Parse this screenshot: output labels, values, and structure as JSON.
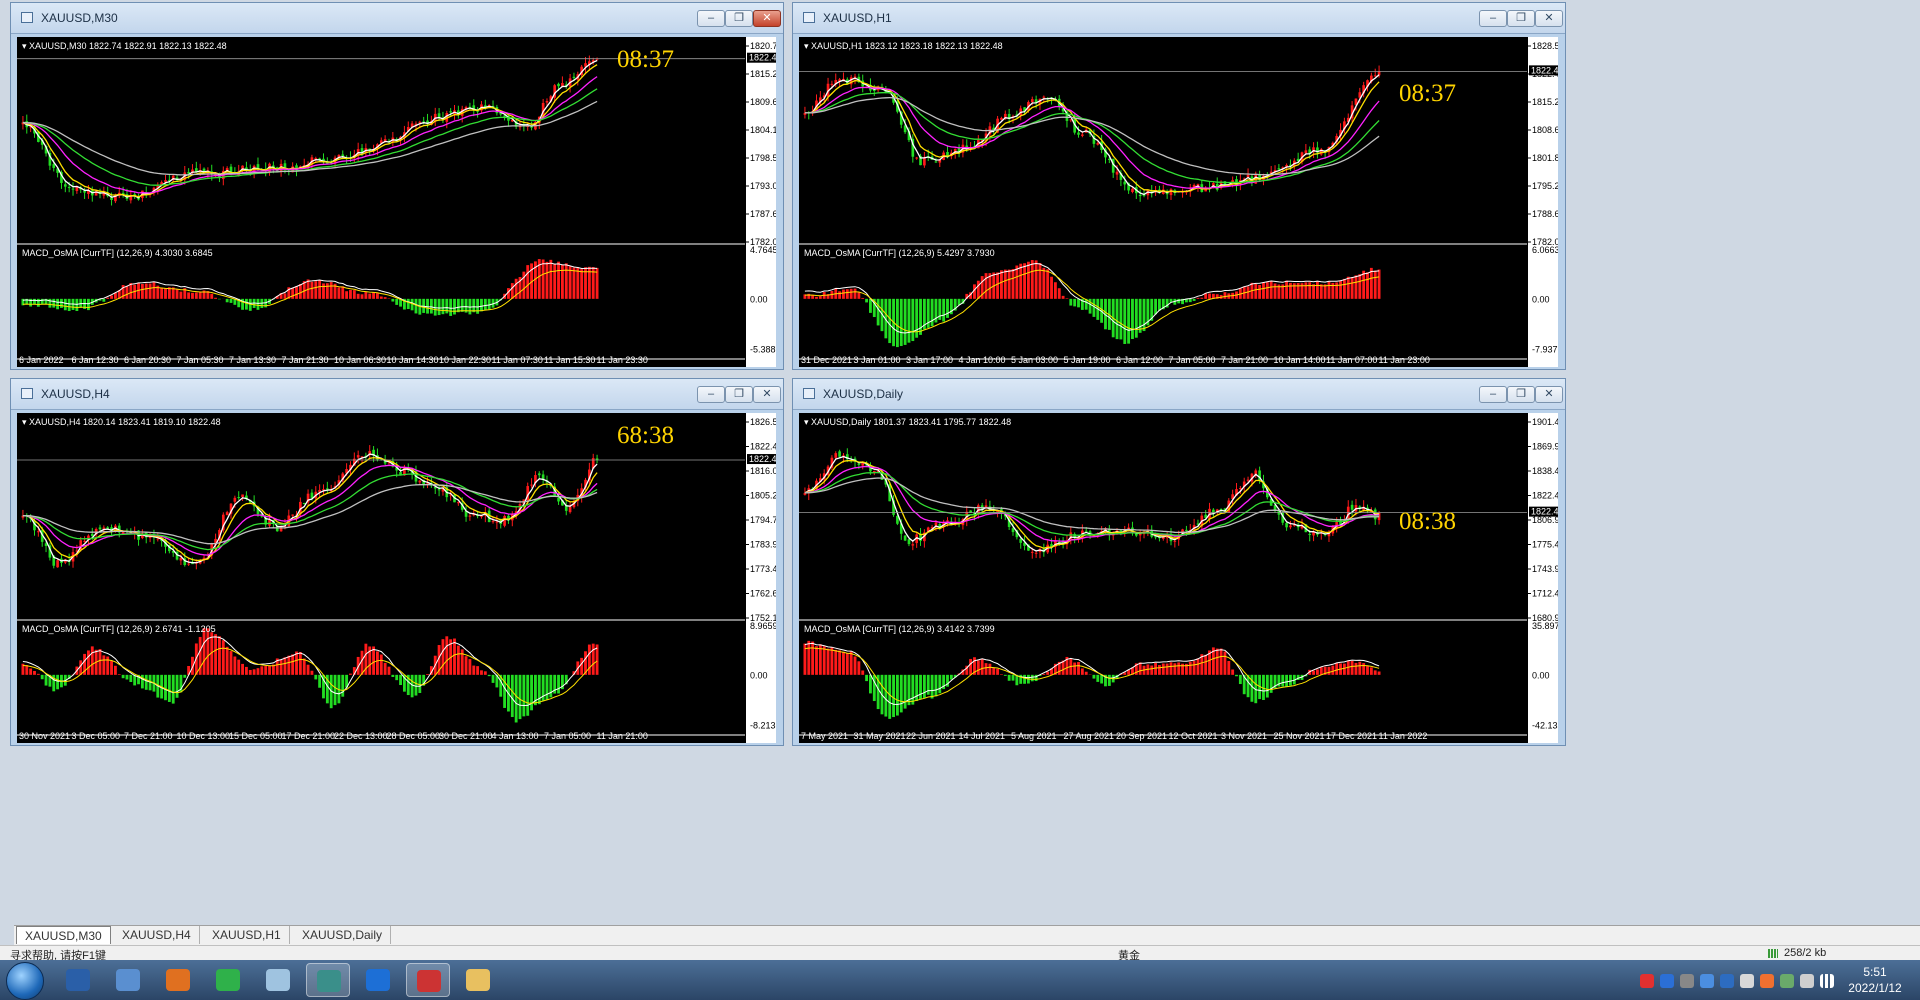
{
  "colors": {
    "background": "#000000",
    "bull": "#ff1a1a",
    "bear": "#22dd22",
    "line_white": "#ffffff",
    "line_yellow": "#ffe000",
    "line_magenta": "#ff22ff",
    "line_green": "#33dd33",
    "line_gray": "#c0c0c0",
    "clock": "#ffd400"
  },
  "windows": [
    {
      "id": "m30",
      "title": "XAUUSD,M30",
      "caption": "XAUUSD,M30  1822.74 1822.91 1822.13 1822.48",
      "price_ticks": [
        "1820.75",
        "1815.20",
        "1809.65",
        "1804.10",
        "1798.55",
        "1793.00",
        "1787.60",
        "1782.05"
      ],
      "current_price": "1822.48",
      "clock": "08:37",
      "macd_caption": "MACD_OsMA [CurrTF] (12,26,9) 4.3030 3.6845",
      "macd_ticks": [
        "4.7645",
        "0.00",
        "-5.3889"
      ],
      "time_ticks": [
        "6 Jan 2022",
        "6 Jan 12:30",
        "6 Jan 20:30",
        "7 Jan 05:30",
        "7 Jan 13:30",
        "7 Jan 21:30",
        "10 Jan 06:30",
        "10 Jan 14:30",
        "10 Jan 22:30",
        "11 Jan 07:30",
        "11 Jan 15:30",
        "11 Jan 23:30"
      ]
    },
    {
      "id": "h1",
      "title": "XAUUSD,H1",
      "caption": "XAUUSD,H1  1823.12 1823.18 1822.13 1822.48",
      "price_ticks": [
        "1828.55",
        "1822.48",
        "1815.20",
        "1808.65",
        "1801.80",
        "1795.20",
        "1788.60",
        "1782.00"
      ],
      "current_price": "1822.48",
      "clock": "08:37",
      "macd_caption": "MACD_OsMA [CurrTF] (12,26,9) 5.4297 3.7930",
      "macd_ticks": [
        "6.0663",
        "0.00",
        "-7.9376"
      ],
      "time_ticks": [
        "31 Dec 2021",
        "3 Jan 01:00",
        "3 Jan 17:00",
        "4 Jan 10:00",
        "5 Jan 03:00",
        "5 Jan 19:00",
        "6 Jan 12:00",
        "7 Jan 05:00",
        "7 Jan 21:00",
        "10 Jan 14:00",
        "11 Jan 07:00",
        "11 Jan 23:00"
      ]
    },
    {
      "id": "h4",
      "title": "XAUUSD,H4",
      "caption": "XAUUSD,H4  1820.14 1823.41 1819.10 1822.48",
      "price_ticks": [
        "1826.50",
        "1822.48",
        "1816.00",
        "1805.20",
        "1794.70",
        "1783.90",
        "1773.40",
        "1762.60",
        "1752.10"
      ],
      "current_price": "1822.48",
      "clock": "68:38",
      "macd_caption": "MACD_OsMA [CurrTF] (12,26,9) 2.6741 -1.1205",
      "macd_ticks": [
        "8.9659",
        "0.00",
        "-8.2131"
      ],
      "time_ticks": [
        "30 Nov 2021",
        "3 Dec 05:00",
        "7 Dec 21:00",
        "10 Dec 13:00",
        "15 Dec 05:00",
        "17 Dec 21:00",
        "22 Dec 13:00",
        "28 Dec 05:00",
        "30 Dec 21:00",
        "4 Jan 13:00",
        "7 Jan 05:00",
        "11 Jan 21:00"
      ]
    },
    {
      "id": "daily",
      "title": "XAUUSD,Daily",
      "caption": "XAUUSD,Daily  1801.37 1823.41 1795.77 1822.48",
      "price_ticks": [
        "1901.40",
        "1869.90",
        "1838.40",
        "1822.48",
        "1806.90",
        "1775.40",
        "1743.90",
        "1712.40",
        "1680.90"
      ],
      "current_price": "1822.48",
      "clock": "08:38",
      "macd_caption": "MACD_OsMA [CurrTF] (12,26,9) 3.4142 3.7399",
      "macd_ticks": [
        "35.8977",
        "0.00",
        "-42.1359"
      ],
      "time_ticks": [
        "7 May 2021",
        "31 May 2021",
        "22 Jun 2021",
        "14 Jul 2021",
        "5 Aug 2021",
        "27 Aug 2021",
        "20 Sep 2021",
        "12 Oct 2021",
        "3 Nov 2021",
        "25 Nov 2021",
        "17 Dec 2021",
        "11 Jan 2022"
      ]
    }
  ],
  "tabs": [
    "XAUUSD,M30",
    "XAUUSD,H4",
    "XAUUSD,H1",
    "XAUUSD,Daily"
  ],
  "active_tab": "XAUUSD,M30",
  "status": {
    "help": "寻求帮助, 请按F1键",
    "symbol": "黄金",
    "traffic": "258/2 kb"
  },
  "taskbar": {
    "time": "5:51",
    "date": "2022/1/12",
    "apps": [
      "desktop-icon",
      "media-icon",
      "browser-icon",
      "wechat-icon",
      "notepad-icon",
      "trading-icon",
      "pen-icon",
      "chart-icon",
      "folder-icon"
    ],
    "app_colors": [
      "#2a5fa8",
      "#5a8fd0",
      "#e07020",
      "#2fb14a",
      "#9fc3e0",
      "#3a8f8a",
      "#1d6fd6",
      "#cc3333",
      "#e8c060"
    ]
  },
  "icons": {
    "minimize": "minimize-icon",
    "restore": "restore-icon",
    "close": "close-icon"
  }
}
